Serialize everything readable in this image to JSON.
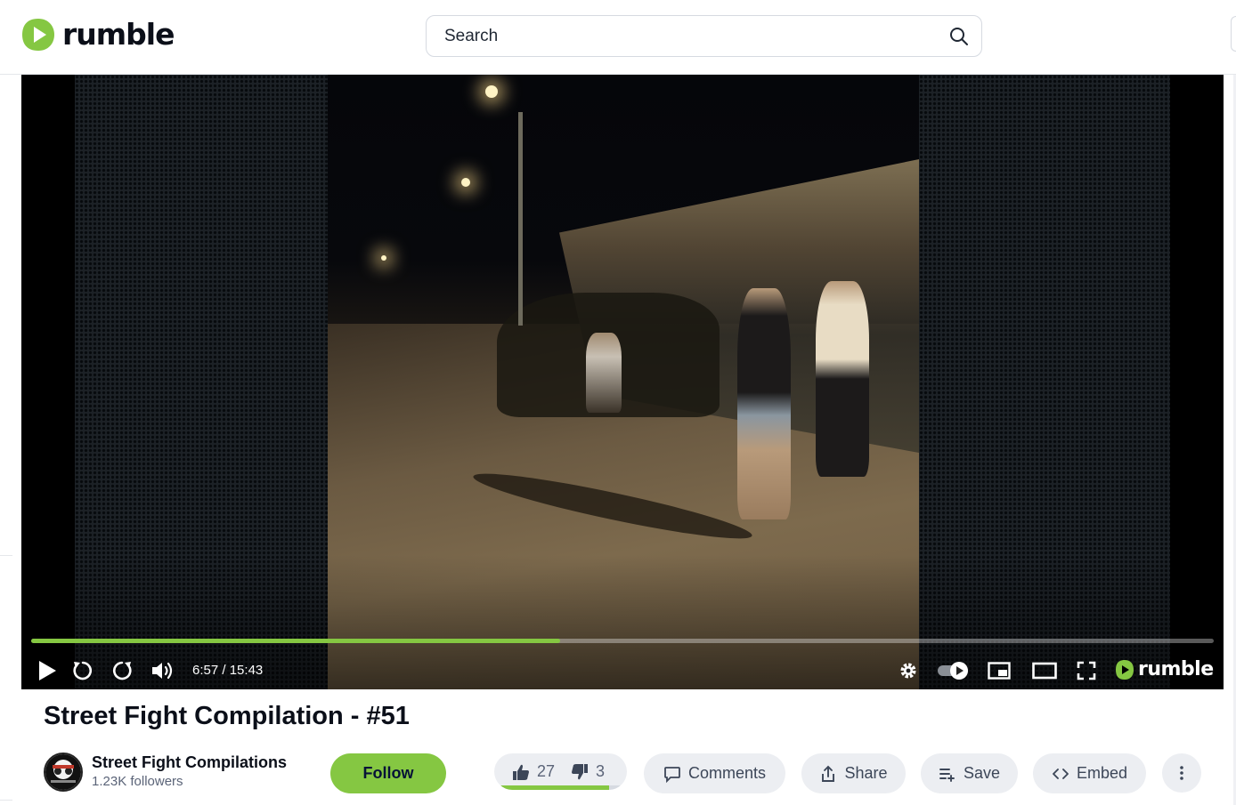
{
  "header": {
    "brand": "rumble",
    "search_placeholder": "Search",
    "brand_color": "#85c742"
  },
  "player": {
    "time_current": "6:57",
    "time_separator": " / ",
    "time_total": "15:43",
    "progress_fraction": 0.447,
    "brand": "rumble",
    "icons": [
      "play-icon",
      "rewind-icon",
      "forward-icon",
      "volume-icon",
      "settings-icon",
      "autoplay-toggle-icon",
      "picture-in-picture-icon",
      "theater-mode-icon",
      "fullscreen-icon"
    ]
  },
  "video": {
    "title": "Street Fight Compilation - #51"
  },
  "channel": {
    "name": "Street Fight Compilations",
    "followers": "1.23K followers",
    "follow_label": "Follow"
  },
  "actions": {
    "likes": "27",
    "dislikes": "3",
    "like_fraction": 0.9,
    "comments_label": "Comments",
    "share_label": "Share",
    "save_label": "Save",
    "embed_label": "Embed"
  }
}
